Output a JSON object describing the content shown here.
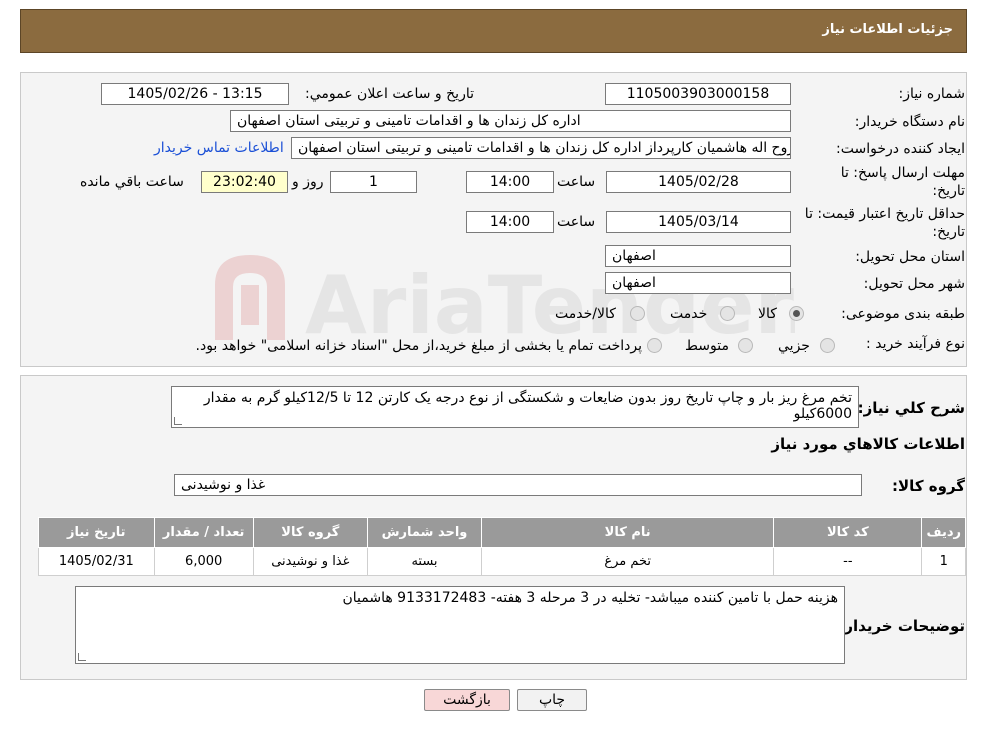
{
  "header": {
    "title": "جزئیات اطلاعات نیاز"
  },
  "watermark": {
    "text": "AriaTender.neT"
  },
  "form": {
    "need_number_label": "شماره نیاز:",
    "need_number": "1105003903000158",
    "announce_label": "تاریخ و ساعت اعلان عمومي:",
    "announce_value": "1405/02/26 - 13:15",
    "buyer_org_label": "نام دستگاه خریدار:",
    "buyer_org": "اداره کل زندان ها و اقدامات تامینی و تربیتی استان اصفهان",
    "creator_label": "ایجاد کننده درخواست:",
    "creator": "روح اله هاشمیان کارپرداز اداره کل زندان ها و اقدامات تامینی و تربیتی استان اصفهان",
    "contact_link": "اطلاعات تماس خریدار",
    "reply_deadline_label_1": "مهلت ارسال پاسخ: تا",
    "reply_deadline_label_2": "تاریخ:",
    "reply_date": "1405/02/28",
    "time_label": "ساعت",
    "reply_time": "14:00",
    "days_value": "1",
    "days_label": "روز و",
    "remaining_time": "23:02:40",
    "remaining_label": "ساعت باقي مانده",
    "price_valid_label_1": "حداقل تاریخ اعتبار قیمت: تا",
    "price_valid_label_2": "تاریخ:",
    "price_valid_date": "1405/03/14",
    "price_valid_time": "14:00",
    "province_label": "استان محل تحویل:",
    "province": "اصفهان",
    "city_label": "شهر محل تحویل:",
    "city": "اصفهان",
    "category_label": "طبقه بندی موضوعی:",
    "category_options": [
      "کالا",
      "خدمت",
      "کالا/خدمت"
    ],
    "category_selected": "کالا",
    "purchase_type_label": "نوع فرآیند خرید :",
    "purchase_options": [
      "جزيي",
      "متوسط"
    ],
    "purchase_note": "پرداخت تمام یا بخشی از مبلغ خرید،از محل \"اسناد خزانه اسلامی\" خواهد بود."
  },
  "need": {
    "description_label": "شرح کلي نیاز:",
    "description": "تخم مرغ ریز بار و چاپ تاریخ روز بدون ضایعات و شکستگی از نوع درجه یک کارتن 12 تا 12/5کیلو گرم به مقدار 6000کیلو",
    "goods_info_title": "اطلاعات کالاهاي مورد نیاز",
    "goods_group_label": "گروه کالا:",
    "goods_group": "غذا و نوشیدنی"
  },
  "table": {
    "headers": [
      "ردیف",
      "کد کالا",
      "نام کالا",
      "واحد شمارش",
      "گروه کالا",
      "تعداد / مقدار",
      "تاریخ نیاز"
    ],
    "rows": [
      [
        "1",
        "--",
        "تخم مرغ",
        "بسته",
        "غذا و نوشیدنی",
        "6,000",
        "1405/02/31"
      ]
    ]
  },
  "buyer_notes": {
    "label": "توضیحات خریدار:",
    "text": "هزینه حمل با تامین کننده میباشد- تخلیه در 3 مرحله 3 هفته- 9133172483 هاشمیان"
  },
  "buttons": {
    "print": "چاپ",
    "back": "بازگشت"
  },
  "colors": {
    "header_bg": "#8b6b3f",
    "print_bg": "#f2f2f2",
    "back_bg": "#f8d7d7",
    "table_header_bg": "#9a9a9a",
    "link": "#1a4fd6"
  }
}
